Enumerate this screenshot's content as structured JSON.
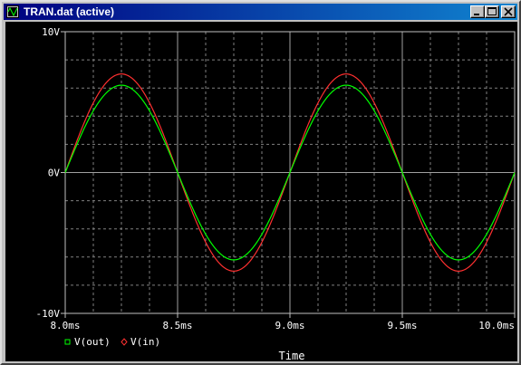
{
  "window": {
    "title": "TRAN.dat (active)",
    "icon": "probe-window-icon",
    "buttons": [
      "minimize",
      "maximize",
      "close"
    ]
  },
  "chart_data": {
    "type": "line",
    "title": "",
    "xlabel": "Time",
    "ylabel": "",
    "xlim": [
      8.0,
      10.0
    ],
    "ylim": [
      -10,
      10
    ],
    "x_unit": "ms",
    "y_unit": "V",
    "x_ticks": [
      "8.0ms",
      "8.5ms",
      "9.0ms",
      "9.5ms",
      "10.0ms"
    ],
    "y_ticks": [
      "10V",
      "0V",
      "-10V"
    ],
    "grid": true,
    "background": "#000000",
    "legend_placement": "bottom-left",
    "series": [
      {
        "name": "V(out)",
        "color": "#00ff00",
        "marker": "square",
        "kind": "sine",
        "amplitude": 6.2,
        "frequency_khz": 1,
        "phase_deg": 0,
        "x": [
          8.0,
          8.125,
          8.25,
          8.375,
          8.5,
          8.625,
          8.75,
          8.875,
          9.0,
          9.125,
          9.25,
          9.375,
          9.5,
          9.625,
          9.75,
          9.875,
          10.0
        ],
        "values": [
          0,
          4.38,
          6.2,
          4.38,
          0,
          -4.38,
          -6.2,
          -4.38,
          0,
          4.38,
          6.2,
          4.38,
          0,
          -4.38,
          -6.2,
          -4.38,
          0
        ]
      },
      {
        "name": "V(in)",
        "color": "#ff3030",
        "marker": "diamond",
        "kind": "sine",
        "amplitude": 7.0,
        "frequency_khz": 1,
        "phase_deg": 0,
        "x": [
          8.0,
          8.125,
          8.25,
          8.375,
          8.5,
          8.625,
          8.75,
          8.875,
          9.0,
          9.125,
          9.25,
          9.375,
          9.5,
          9.625,
          9.75,
          9.875,
          10.0
        ],
        "values": [
          0,
          4.95,
          7.0,
          4.95,
          0,
          -4.95,
          -7.0,
          -4.95,
          0,
          4.95,
          7.0,
          4.95,
          0,
          -4.95,
          -7.0,
          -4.95,
          0
        ]
      }
    ]
  }
}
